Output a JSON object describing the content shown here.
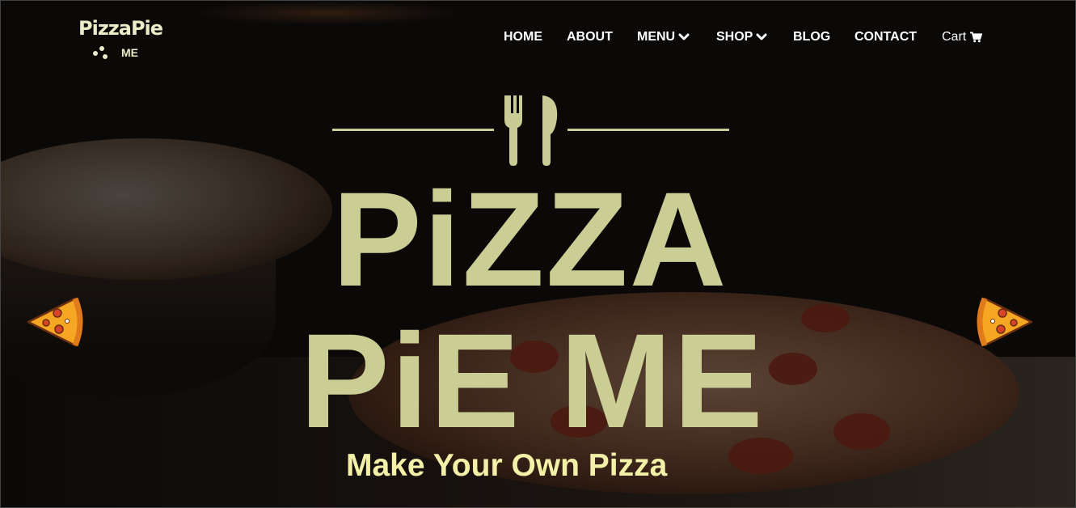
{
  "logo": {
    "line1": "PizzaPie",
    "line2": "ME"
  },
  "nav": {
    "home": "HOME",
    "about": "ABOUT",
    "menu": "MENU",
    "shop": "SHOP",
    "blog": "BLOG",
    "contact": "CONTACT",
    "cart": "Cart"
  },
  "hero": {
    "title_line1": "PiZZA",
    "title_line2": "PiE ME",
    "tagline": "Make Your Own Pizza"
  },
  "colors": {
    "title": "#cacd94",
    "tagline": "#f3f0a8",
    "accent": "#f5a623",
    "nav_text": "#ffffff"
  },
  "icons": {
    "menu_dropdown": "chevron-down-icon",
    "shop_dropdown": "chevron-down-icon",
    "cart": "shopping-cart-icon",
    "emblem": "fork-knife-icon",
    "prev": "pizza-slice-left-icon",
    "next": "pizza-slice-right-icon"
  }
}
